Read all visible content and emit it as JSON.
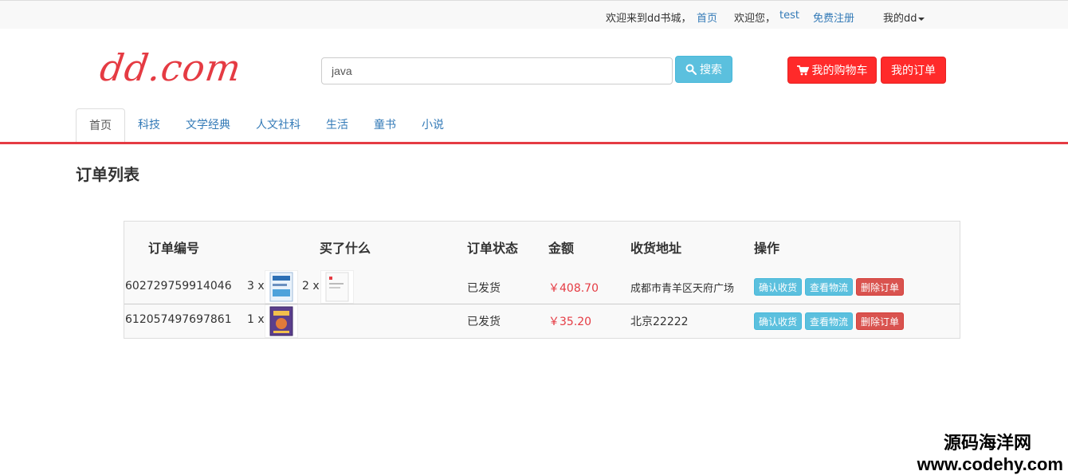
{
  "topbar": {
    "welcome": "欢迎来到dd书城，",
    "home_link": "首页",
    "greeting": "欢迎您，",
    "username": "test",
    "register": "免费注册",
    "my_dd": "我的dd"
  },
  "header": {
    "logo": "dd.com",
    "search_placeholder": "java",
    "search_button": "搜索",
    "cart_button": "我的购物车",
    "orders_button": "我的订单"
  },
  "nav": {
    "tabs": [
      "首页",
      "科技",
      "文学经典",
      "人文社科",
      "生活",
      "童书",
      "小说"
    ]
  },
  "page": {
    "title": "订单列表"
  },
  "table": {
    "headers": [
      "订单编号",
      "买了什么",
      "订单状态",
      "金额",
      "收货地址",
      "操作"
    ],
    "rows": [
      {
        "order_id": "602729759914046",
        "items": [
          {
            "qty": "3 x"
          },
          {
            "qty": "2 x"
          }
        ],
        "status": "已发货",
        "amount": "￥408.70",
        "address": "成都市青羊区天府广场",
        "actions": [
          "确认收货",
          "查看物流",
          "删除订单"
        ]
      },
      {
        "order_id": "612057497697861",
        "items": [
          {
            "qty": "1 x"
          }
        ],
        "status": "已发货",
        "amount": "￥35.20",
        "address": "北京22222",
        "actions": [
          "确认收货",
          "查看物流",
          "删除订单"
        ]
      }
    ]
  },
  "watermark": {
    "cn": "源码海洋网",
    "en": "www.codehy.com"
  },
  "colors": {
    "brand_red": "#e53b43",
    "info": "#5bc0de",
    "danger": "#d9534f",
    "link": "#337ab7"
  }
}
